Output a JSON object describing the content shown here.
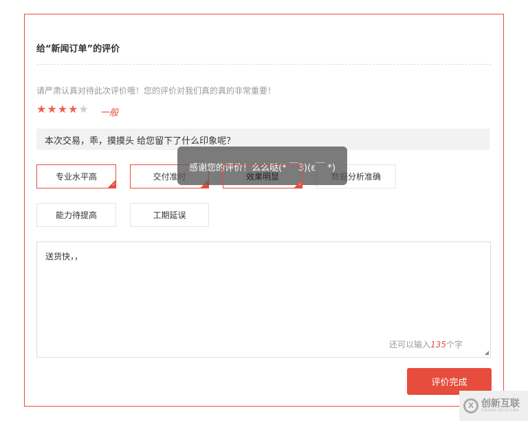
{
  "title": "给“新闻订单”的评价",
  "hint": "请严肃认真对待此次评价哦！您的评价对我们真的真的非常重要！",
  "rating": {
    "value": 4,
    "max": 5,
    "label": "一般"
  },
  "question": "本次交易，乖，摸摸头 给您留下了什么印象呢？",
  "tags": [
    {
      "label": "专业水平高",
      "selected": true
    },
    {
      "label": "交付准时",
      "selected": true
    },
    {
      "label": "效果明显",
      "selected": true
    },
    {
      "label": "数据分析准确",
      "selected": false
    },
    {
      "label": "能力待提高",
      "selected": false
    },
    {
      "label": "工期延误",
      "selected": false
    }
  ],
  "comment": {
    "value": "送货快，，",
    "remaining_prefix": "还可以输入",
    "remaining": "135",
    "remaining_suffix": "个字"
  },
  "submit_label": "评价完成",
  "toast": "感谢您的评价！么么哒(* ￣3)(ε￣ *)",
  "watermark": {
    "name": "创新互联",
    "sub": "CHUANG XIN HU LIAN"
  }
}
